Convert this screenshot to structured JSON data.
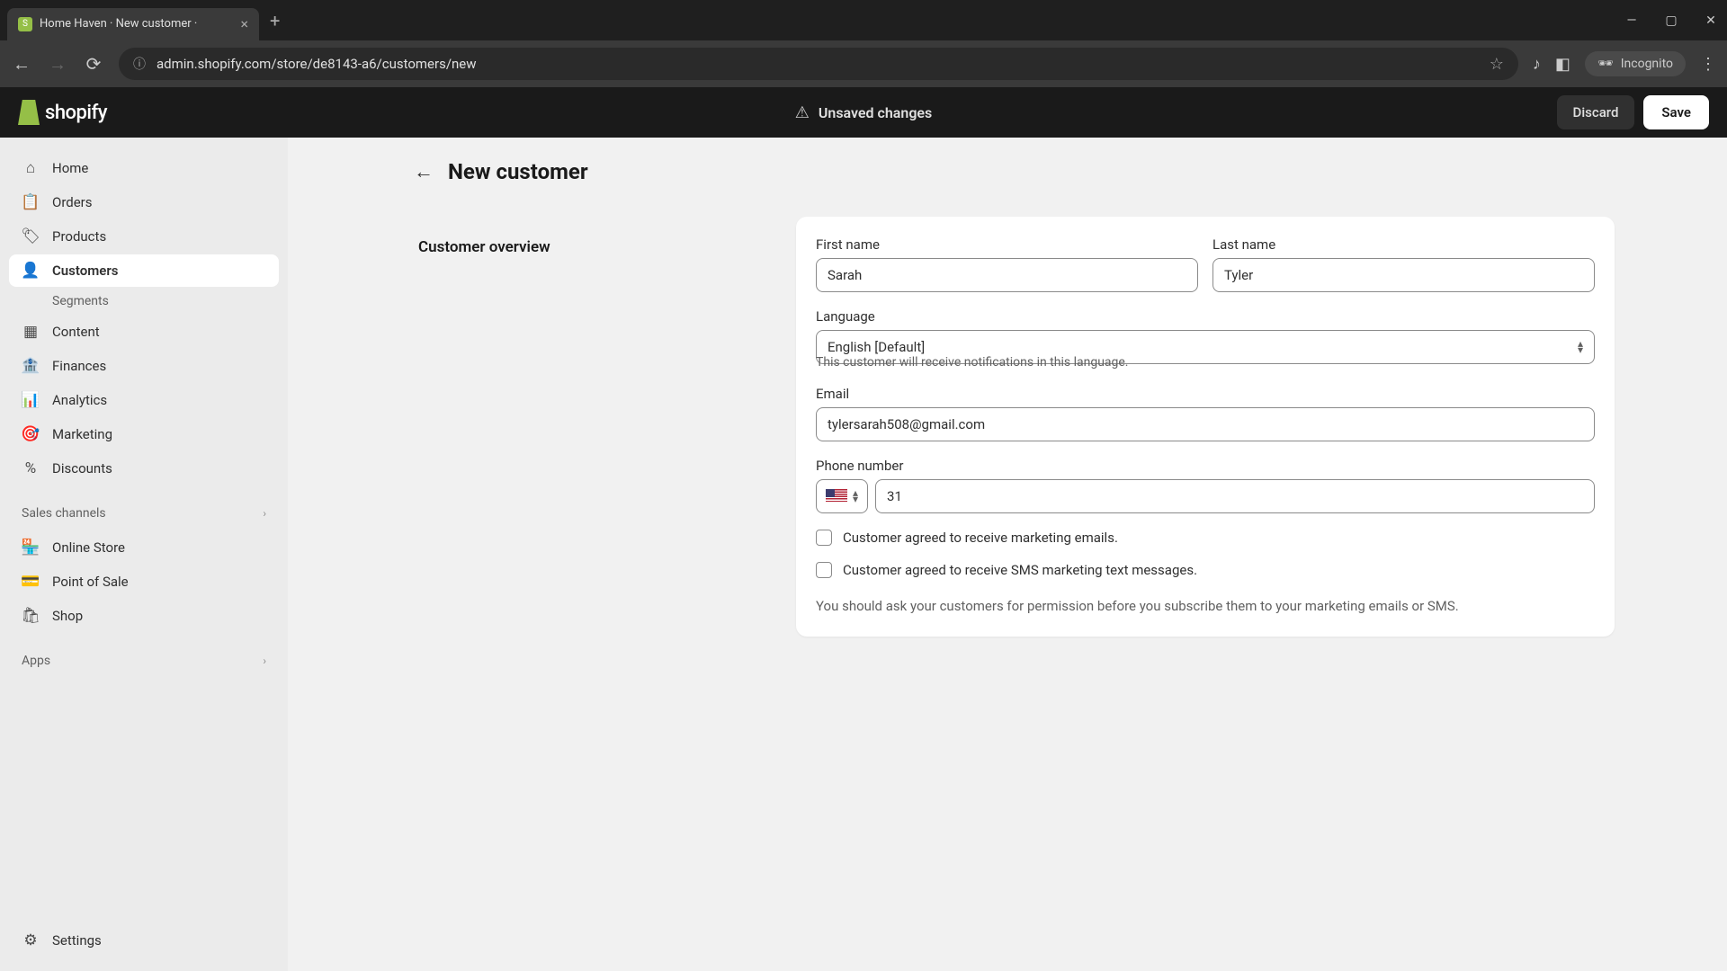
{
  "browser": {
    "tab_title": "Home Haven · New customer ·",
    "url": "admin.shopify.com/store/de8143-a6/customers/new",
    "incognito_label": "Incognito"
  },
  "topbar": {
    "logo_text": "shopify",
    "unsaved_label": "Unsaved changes",
    "discard_label": "Discard",
    "save_label": "Save"
  },
  "sidebar": {
    "items": [
      {
        "label": "Home"
      },
      {
        "label": "Orders"
      },
      {
        "label": "Products"
      },
      {
        "label": "Customers"
      },
      {
        "label": "Content"
      },
      {
        "label": "Finances"
      },
      {
        "label": "Analytics"
      },
      {
        "label": "Marketing"
      },
      {
        "label": "Discounts"
      }
    ],
    "customers_sub": "Segments",
    "section_sales": "Sales channels",
    "sales_items": [
      {
        "label": "Online Store"
      },
      {
        "label": "Point of Sale"
      },
      {
        "label": "Shop"
      }
    ],
    "section_apps": "Apps",
    "settings_label": "Settings"
  },
  "page": {
    "title": "New customer",
    "section_title": "Customer overview",
    "first_name_label": "First name",
    "first_name_value": "Sarah",
    "last_name_label": "Last name",
    "last_name_value": "Tyler",
    "language_label": "Language",
    "language_value": "English [Default]",
    "language_helper": "This customer will receive notifications in this language.",
    "email_label": "Email",
    "email_value": "tylersarah508@gmail.com",
    "phone_label": "Phone number",
    "phone_value": "31",
    "checkbox_email": "Customer agreed to receive marketing emails.",
    "checkbox_sms": "Customer agreed to receive SMS marketing text messages.",
    "disclaimer": "You should ask your customers for permission before you subscribe them to your marketing emails or SMS."
  }
}
